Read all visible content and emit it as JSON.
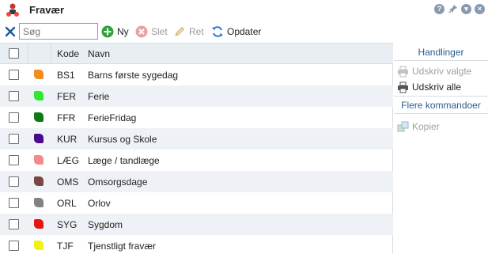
{
  "window": {
    "title": "Fravær",
    "icons": [
      "help-icon",
      "pin-icon",
      "restore-icon",
      "close-icon"
    ]
  },
  "toolbar": {
    "search_value": "",
    "search_placeholder": "Søg",
    "new_label": "Ny",
    "delete_label": "Slet",
    "edit_label": "Ret",
    "refresh_label": "Opdater"
  },
  "grid": {
    "columns": {
      "code": "Kode",
      "name": "Navn"
    },
    "rows": [
      {
        "code": "BS1",
        "name": "Barns første sygedag",
        "color": "#f28c1a"
      },
      {
        "code": "FER",
        "name": "Ferie",
        "color": "#2de82d"
      },
      {
        "code": "FFR",
        "name": "FerieFridag",
        "color": "#0f7a14"
      },
      {
        "code": "KUR",
        "name": "Kursus og Skole",
        "color": "#4a0a8c"
      },
      {
        "code": "LÆG",
        "name": "Læge / tandlæge",
        "color": "#f48a8a"
      },
      {
        "code": "OMS",
        "name": "Omsorgsdage",
        "color": "#7a4646"
      },
      {
        "code": "ORL",
        "name": "Orlov",
        "color": "#828282"
      },
      {
        "code": "SYG",
        "name": "Sygdom",
        "color": "#e81414"
      },
      {
        "code": "TJF",
        "name": "Tjenstligt fravær",
        "color": "#f2f20f"
      }
    ]
  },
  "side": {
    "actions_title": "Handlinger",
    "print_selected": "Udskriv valgte",
    "print_all": "Udskriv alle",
    "more_title": "Flere kommandoer",
    "copy": "Kopier"
  }
}
